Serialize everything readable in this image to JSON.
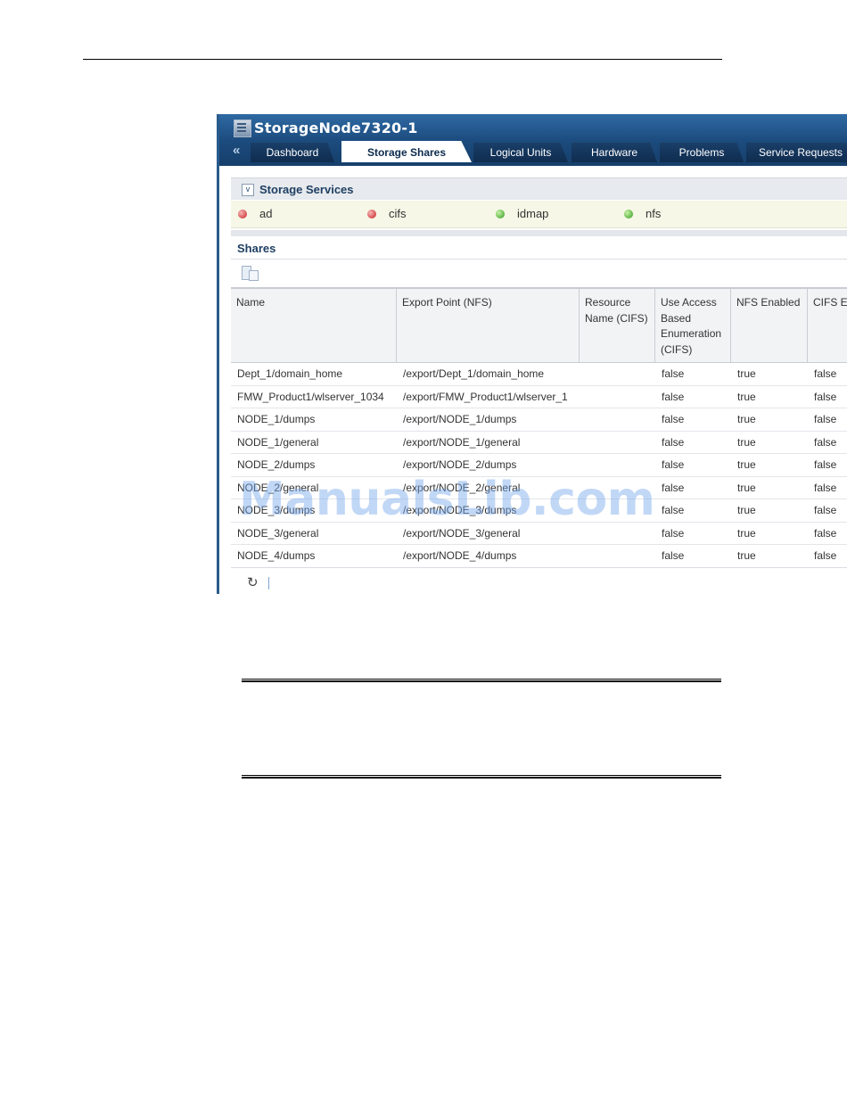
{
  "app": {
    "title": "StorageNode7320-1",
    "collapse_glyph": "«"
  },
  "tabs": [
    {
      "label": "Dashboard",
      "active": false
    },
    {
      "label": "Storage Shares",
      "active": true
    },
    {
      "label": "Logical Units",
      "active": false
    },
    {
      "label": "Hardware",
      "active": false
    },
    {
      "label": "Problems",
      "active": false
    },
    {
      "label": "Service Requests",
      "active": false
    }
  ],
  "storage_services": {
    "title": "Storage Services",
    "toggle_glyph": "v",
    "items": [
      {
        "name": "ad",
        "status": "error",
        "color": "#c71c1c"
      },
      {
        "name": "cifs",
        "status": "error",
        "color": "#c71c1c"
      },
      {
        "name": "idmap",
        "status": "ok",
        "color": "#2d9a1d"
      },
      {
        "name": "nfs",
        "status": "ok",
        "color": "#2d9a1d"
      }
    ]
  },
  "shares": {
    "title": "Shares",
    "columns": [
      "Name",
      "Export Point (NFS)",
      "Resource Name (CIFS)",
      "Use Access Based Enumeration (CIFS)",
      "NFS Enabled",
      "CIFS En"
    ],
    "rows": [
      [
        "Dept_1/domain_home",
        "/export/Dept_1/domain_home",
        "",
        "false",
        "true",
        "false"
      ],
      [
        "FMW_Product1/wlserver_1034",
        "/export/FMW_Product1/wlserver_1",
        "",
        "false",
        "true",
        "false"
      ],
      [
        "NODE_1/dumps",
        "/export/NODE_1/dumps",
        "",
        "false",
        "true",
        "false"
      ],
      [
        "NODE_1/general",
        "/export/NODE_1/general",
        "",
        "false",
        "true",
        "false"
      ],
      [
        "NODE_2/dumps",
        "/export/NODE_2/dumps",
        "",
        "false",
        "true",
        "false"
      ],
      [
        "NODE_2/general",
        "/export/NODE_2/general",
        "",
        "false",
        "true",
        "false"
      ],
      [
        "NODE_3/dumps",
        "/export/NODE_3/dumps",
        "",
        "false",
        "true",
        "false"
      ],
      [
        "NODE_3/general",
        "/export/NODE_3/general",
        "",
        "false",
        "true",
        "false"
      ],
      [
        "NODE_4/dumps",
        "/export/NODE_4/dumps",
        "",
        "false",
        "true",
        "false"
      ]
    ],
    "refresh_glyph": "↻"
  },
  "watermark": "ManualsLib.com"
}
